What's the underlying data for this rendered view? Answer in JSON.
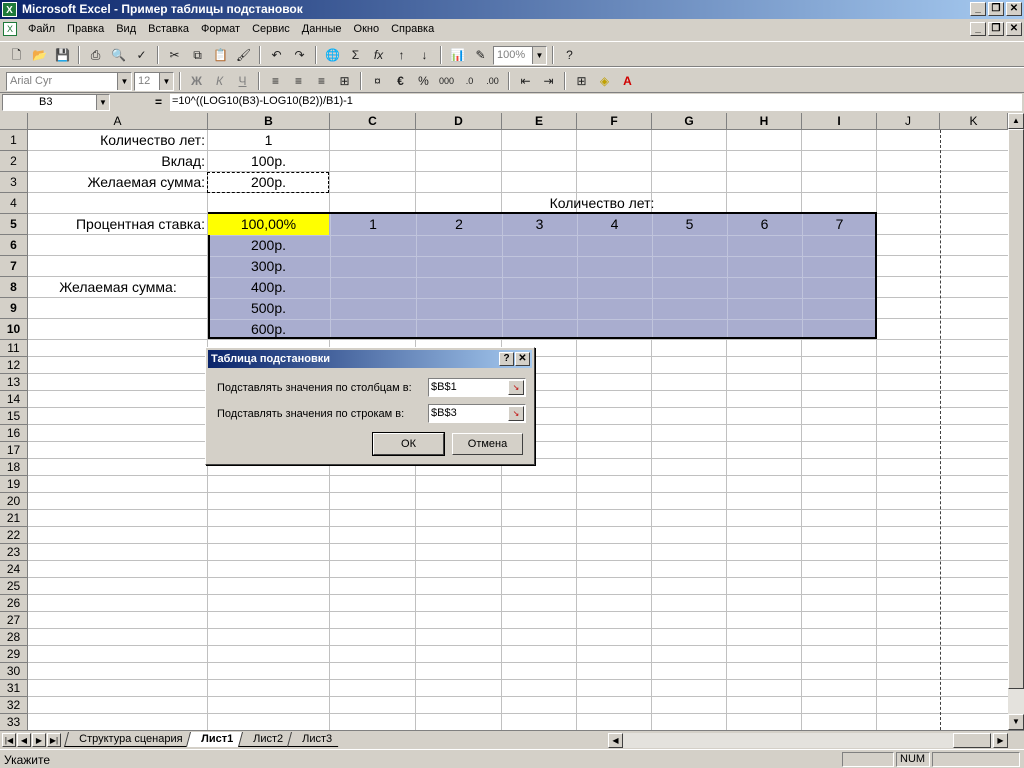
{
  "app": {
    "title": "Microsoft Excel - Пример таблицы подстановок"
  },
  "window_buttons": [
    "_",
    "❐",
    "✕"
  ],
  "menu": [
    "Файл",
    "Правка",
    "Вид",
    "Вставка",
    "Формат",
    "Сервис",
    "Данные",
    "Окно",
    "Справка"
  ],
  "toolbar": {
    "zoom": "100%",
    "font": "Arial Cyr",
    "size": "12",
    "bold": "Ж",
    "italic": "К",
    "underline": "Ч",
    "euro": "€",
    "percent": "%",
    "thousands": "000",
    "sigma": "Σ",
    "fx": "fx"
  },
  "formula_bar": {
    "name_box": "B3",
    "equals": "=",
    "formula": "=10^((LOG10(B3)-LOG10(B2))/B1)-1"
  },
  "columns": [
    "A",
    "B",
    "C",
    "D",
    "E",
    "F",
    "G",
    "H",
    "I",
    "J",
    "K"
  ],
  "rows": [
    "1",
    "2",
    "3",
    "4",
    "5",
    "6",
    "7",
    "8",
    "9",
    "10",
    "11",
    "12",
    "13",
    "14",
    "15",
    "16",
    "17",
    "18",
    "19",
    "20",
    "21",
    "22",
    "23",
    "24",
    "25",
    "26",
    "27",
    "28",
    "29",
    "30",
    "31",
    "32",
    "33"
  ],
  "cells": {
    "A1": "Количество лет:",
    "B1": "1",
    "A2": "Вклад:",
    "B2": "100р.",
    "A3": "Желаемая сумма:",
    "B3": "200р.",
    "E4": "Количество лет:",
    "A5": "Процентная ставка:",
    "B5": "100,00%",
    "years": [
      "1",
      "2",
      "3",
      "4",
      "5",
      "6",
      "7"
    ],
    "A8": "Желаемая сумма:",
    "sums": [
      "200р.",
      "300р.",
      "400р.",
      "500р.",
      "600р."
    ]
  },
  "sheet_tabs": [
    "Структура сценария",
    "Лист1",
    "Лист2",
    "Лист3"
  ],
  "active_tab": "Лист1",
  "status": {
    "text": "Укажите",
    "mode": "NUM"
  },
  "dialog": {
    "title": "Таблица подстановки",
    "help": "?",
    "close": "✕",
    "col_label": "Подставлять значения по столбцам в:",
    "col_value": "$B$1",
    "row_label": "Подставлять значения по строкам в:",
    "row_value": "$B$3",
    "ok": "ОК",
    "cancel": "Отмена"
  }
}
